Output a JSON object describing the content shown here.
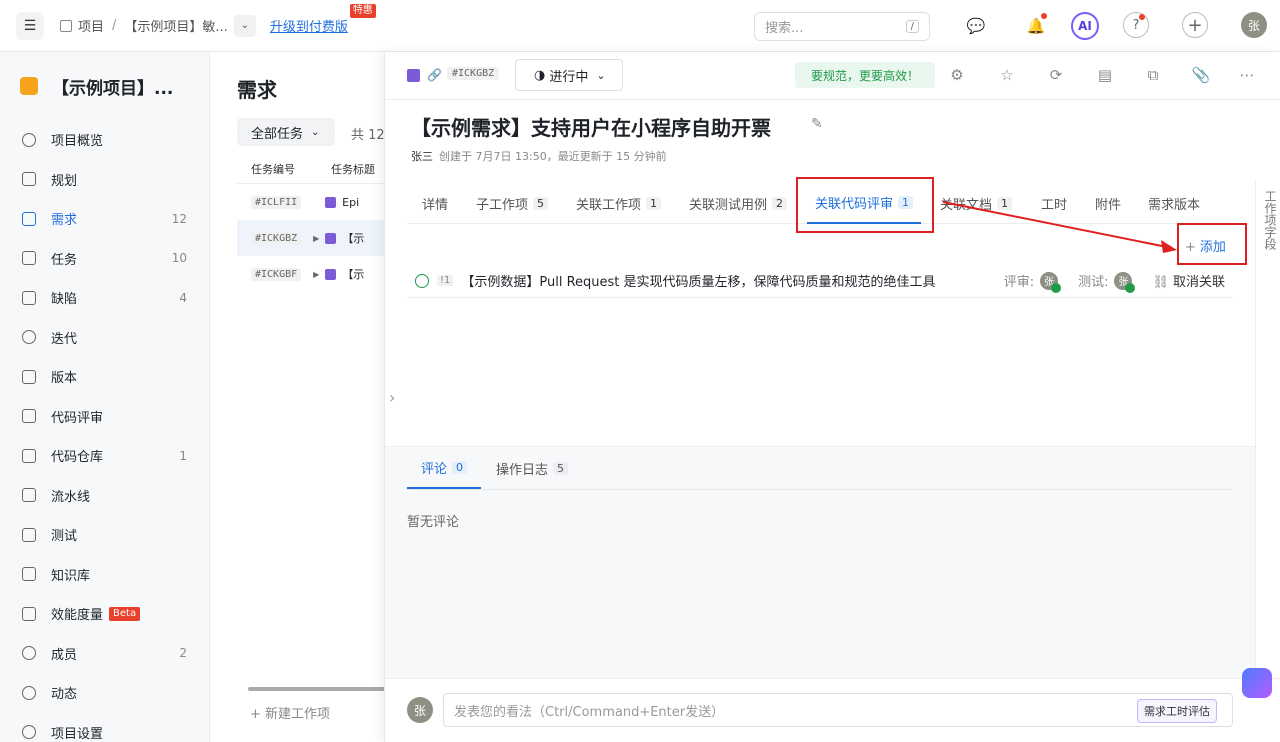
{
  "topbar": {
    "crumb_root": "项目",
    "crumb_project": "【示例项目】敏...",
    "upgrade_label": "升级到付费版",
    "upgrade_tag": "特惠",
    "search_placeholder": "搜索...",
    "search_shortcut": "/",
    "ai_label": "AI",
    "help_label": "?",
    "add_label": "+",
    "user_initial": "张"
  },
  "sidebar": {
    "project_name": "【示例项目】...",
    "items": [
      {
        "label": "项目概览",
        "count": ""
      },
      {
        "label": "规划",
        "count": ""
      },
      {
        "label": "需求",
        "count": "12"
      },
      {
        "label": "任务",
        "count": "10"
      },
      {
        "label": "缺陷",
        "count": "4"
      },
      {
        "label": "迭代",
        "count": ""
      },
      {
        "label": "版本",
        "count": ""
      },
      {
        "label": "代码评审",
        "count": ""
      },
      {
        "label": "代码仓库",
        "count": "1"
      },
      {
        "label": "流水线",
        "count": ""
      },
      {
        "label": "测试",
        "count": ""
      },
      {
        "label": "知识库",
        "count": ""
      },
      {
        "label": "效能度量",
        "count": "",
        "badge": "Beta"
      },
      {
        "label": "成员",
        "count": "2"
      },
      {
        "label": "动态",
        "count": ""
      },
      {
        "label": "项目设置",
        "count": ""
      }
    ]
  },
  "list": {
    "title": "需求",
    "filter_label": "全部任务",
    "total_label": "共 12",
    "col_code": "任务编号",
    "col_title": "任务标题",
    "rows": [
      {
        "code": "#ICLFII",
        "title": "Epi"
      },
      {
        "code": "#ICKGBZ",
        "title": "【示"
      },
      {
        "code": "#ICKGBF",
        "title": "【示"
      }
    ],
    "new_item_label": "+ 新建工作项"
  },
  "panel": {
    "code": "#ICKGBZ",
    "status": "进行中",
    "promo": "要规范，更要高效！",
    "title": "【示例需求】支持用户在小程序自助开票",
    "author": "张三",
    "meta_text": "创建于 7月7日 13:50，最近更新于 15 分钟前",
    "tabs": [
      {
        "label": "详情",
        "count": ""
      },
      {
        "label": "子工作项",
        "count": "5"
      },
      {
        "label": "关联工作项",
        "count": "1"
      },
      {
        "label": "关联测试用例",
        "count": "2"
      },
      {
        "label": "关联代码评审",
        "count": "1"
      },
      {
        "label": "关联文档",
        "count": "1"
      },
      {
        "label": "工时",
        "count": ""
      },
      {
        "label": "附件",
        "count": ""
      },
      {
        "label": "需求版本",
        "count": ""
      }
    ],
    "add_label": "添加",
    "review": {
      "priority": "!1",
      "title": "【示例数据】Pull Request 是实现代码质量左移，保障代码质量和规范的绝佳工具",
      "reviewer_label": "评审:",
      "tester_label": "测试:",
      "reviewer_initial": "张",
      "tester_initial": "张",
      "unlink_label": "取消关联"
    },
    "right_rail_label": "工作项字段",
    "comments": {
      "tab_comment": "评论",
      "comment_count": "0",
      "tab_log": "操作日志",
      "log_count": "5",
      "empty_text": "暂无评论",
      "input_placeholder": "发表您的看法（Ctrl/Command+Enter发送）",
      "eval_label": "需求工时评估",
      "user_initial": "张"
    }
  },
  "colors": {
    "accent": "#1f6fdb",
    "highlight_box": "#e02020",
    "promo_green": "#1f9b4a",
    "project_logo": "#f7a21b"
  }
}
